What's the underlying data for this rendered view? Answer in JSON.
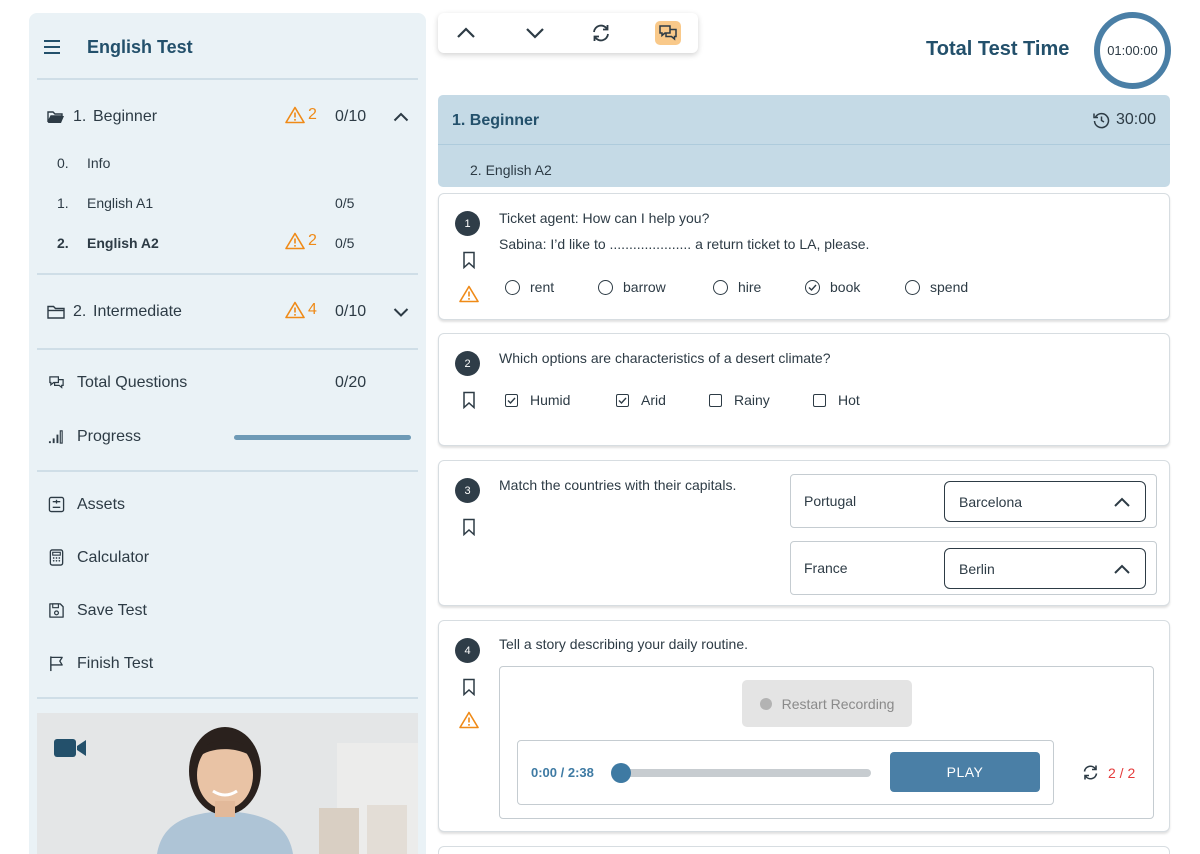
{
  "sidebar": {
    "title": "English Test",
    "sections": [
      {
        "number": "1.",
        "label": "Beginner",
        "warnings": "2",
        "count": "0/10",
        "expanded": true,
        "items": [
          {
            "number": "0.",
            "label": "Info",
            "count": ""
          },
          {
            "number": "1.",
            "label": "English A1",
            "count": "0/5"
          },
          {
            "number": "2.",
            "label": "English A2",
            "warnings": "2",
            "count": "0/5"
          }
        ]
      },
      {
        "number": "2.",
        "label": "Intermediate",
        "warnings": "4",
        "count": "0/10",
        "expanded": false
      }
    ],
    "total_questions": {
      "label": "Total Questions",
      "value": "0/20"
    },
    "progress": {
      "label": "Progress",
      "fraction": 1.0
    },
    "tools": {
      "assets": "Assets",
      "calculator": "Calculator",
      "save": "Save Test",
      "finish": "Finish Test"
    }
  },
  "header": {
    "total_time_label": "Total Test Time",
    "total_time": "01:00:00"
  },
  "section": {
    "title": "1. Beginner",
    "time": "30:00",
    "subsection": "2. English A2"
  },
  "questions": [
    {
      "number": "1",
      "line1": "Ticket agent: How can I help you?",
      "line2": "Sabina: I’d like to ..................... a return ticket to LA, please.",
      "options": [
        "rent",
        "barrow",
        "hire",
        "book",
        "spend"
      ],
      "selected": "book",
      "flagged": true
    },
    {
      "number": "2",
      "text": "Which options are characteristics of a desert climate?",
      "options": [
        "Humid",
        "Arid",
        "Rainy",
        "Hot"
      ],
      "checked": [
        "Humid",
        "Arid"
      ]
    },
    {
      "number": "3",
      "text": "Match the countries with their capitals.",
      "pairs": [
        {
          "country": "Portugal",
          "answer": "Barcelona"
        },
        {
          "country": "France",
          "answer": "Berlin"
        }
      ]
    },
    {
      "number": "4",
      "text": "Tell a story describing your daily routine.",
      "restart_label": "Restart Recording",
      "time": "0:00 / 2:38",
      "play_label": "PLAY",
      "attempts": "2 / 2",
      "flagged": true
    }
  ],
  "colors": {
    "sidebar_bg": "#eaf2f6",
    "primary": "#4a7fa6",
    "title": "#23506b",
    "warning": "#ef8a17",
    "danger": "#e53b3b",
    "section_bg": "#c5dae6"
  }
}
